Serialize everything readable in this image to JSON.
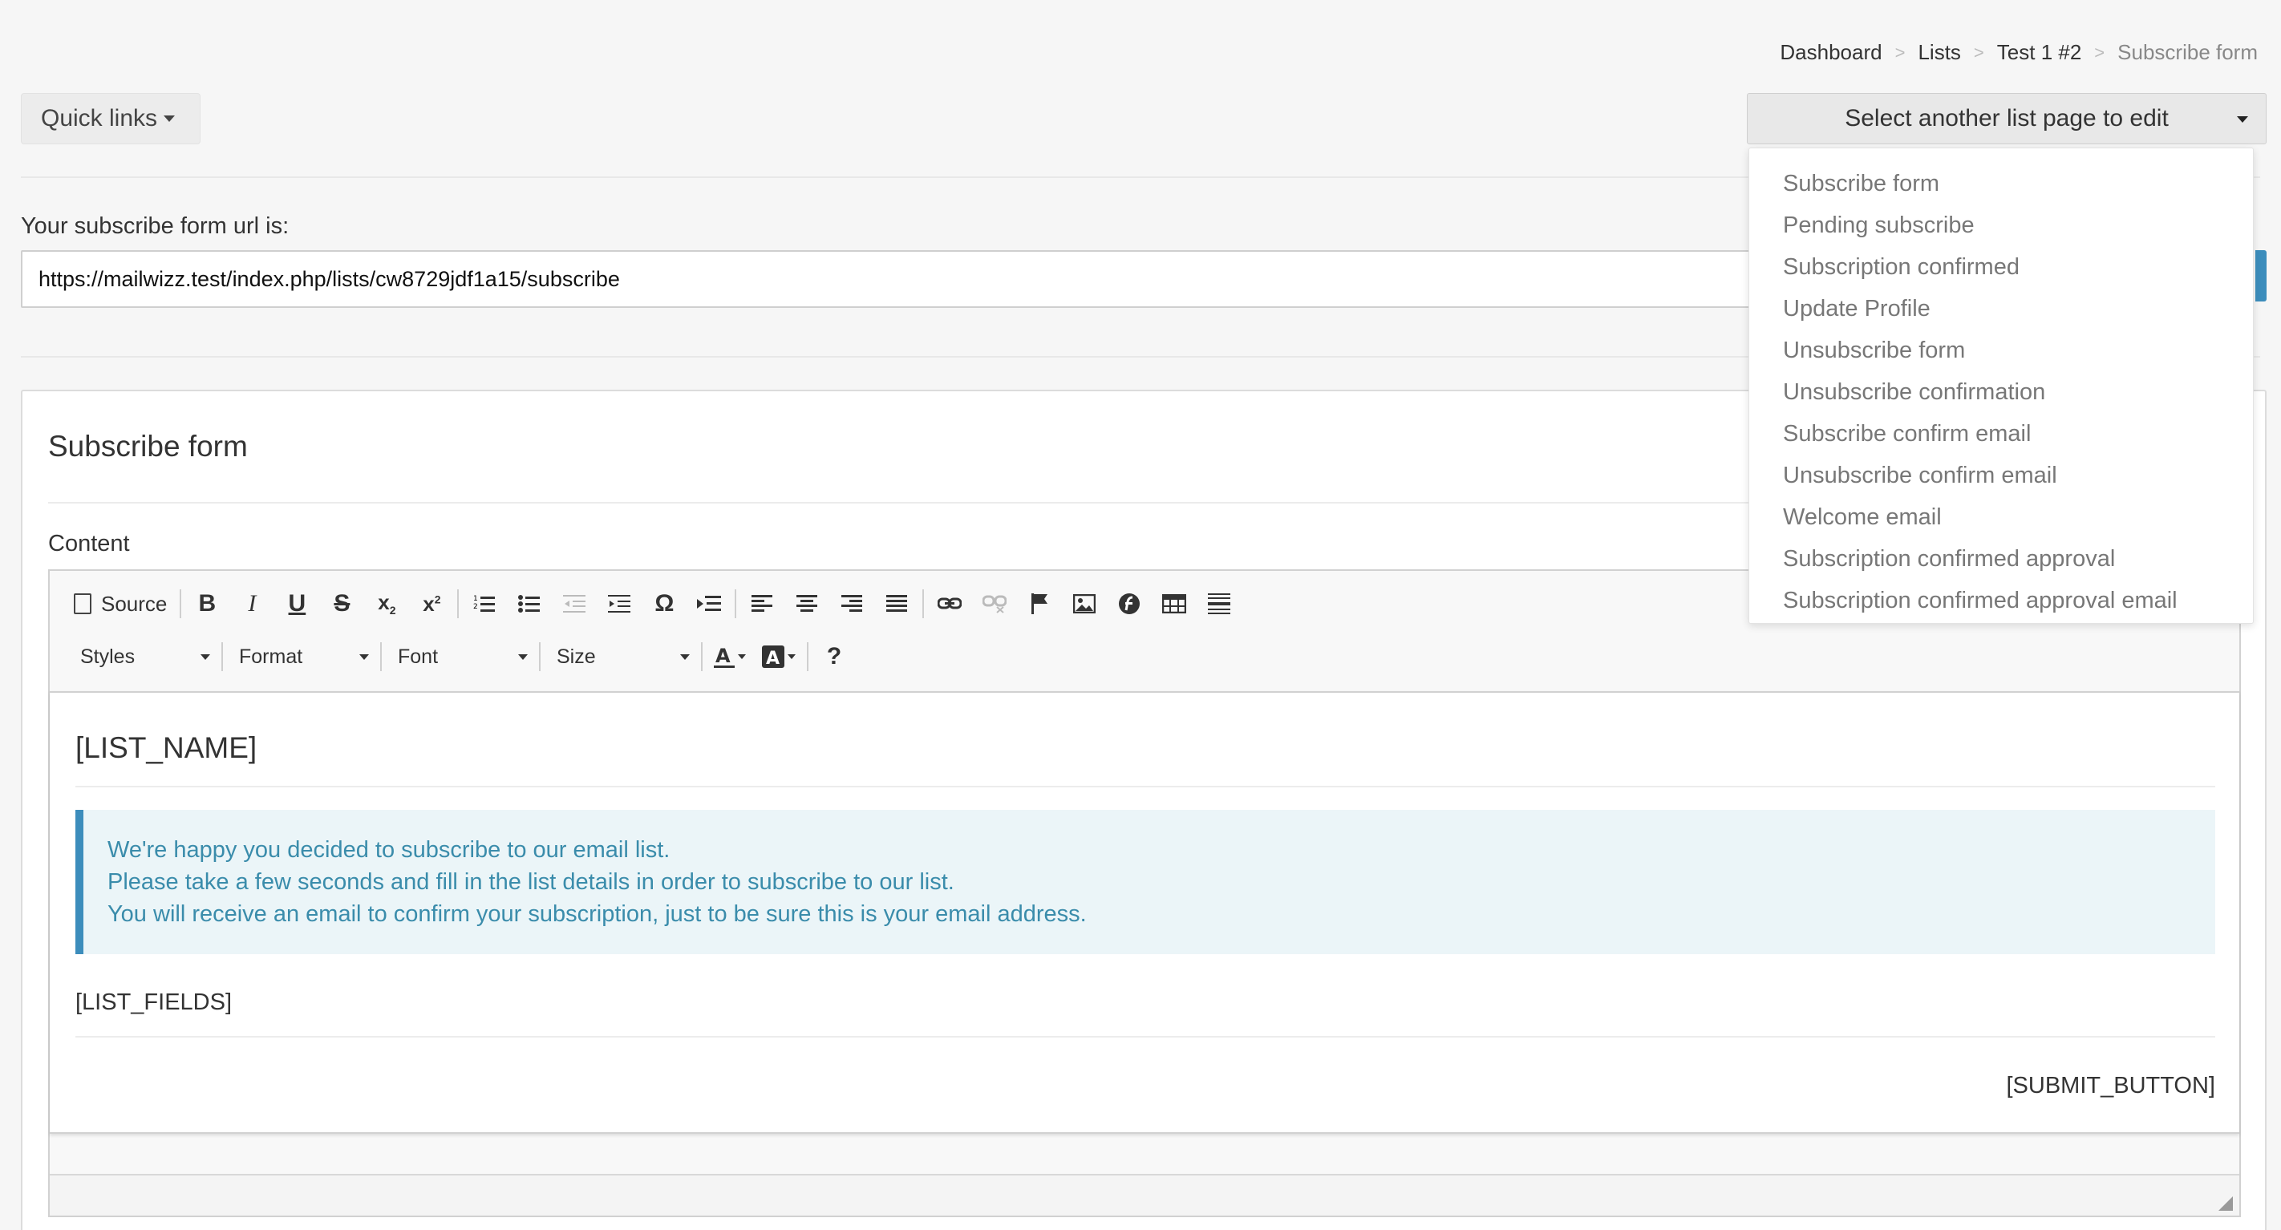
{
  "breadcrumb": {
    "items": [
      "Dashboard",
      "Lists",
      "Test 1 #2",
      "Subscribe form"
    ],
    "separator": ">"
  },
  "quick_links": {
    "label": "Quick links"
  },
  "select_page": {
    "label": "Select another list page to edit",
    "options": [
      "Subscribe form",
      "Pending subscribe",
      "Subscription confirmed",
      "Update Profile",
      "Unsubscribe form",
      "Unsubscribe confirmation",
      "Subscribe confirm email",
      "Unsubscribe confirm email",
      "Welcome email",
      "Subscription confirmed approval",
      "Subscription confirmed approval email"
    ]
  },
  "subscribe_url": {
    "label": "Your subscribe form url is:",
    "value": "https://mailwizz.test/index.php/lists/cw8729jdf1a15/subscribe"
  },
  "box": {
    "title": "Subscribe form",
    "content_label": "Content"
  },
  "editor": {
    "toolbar": {
      "source_label": "Source",
      "styles_label": "Styles",
      "format_label": "Format",
      "font_label": "Font",
      "size_label": "Size",
      "help_label": "?"
    },
    "body": {
      "list_name": "[LIST_NAME]",
      "callout_lines": [
        "We're happy you decided to subscribe to our email list.",
        "Please take a few seconds and fill in the list details in order to subscribe to our list.",
        "You will receive an email to confirm your subscription, just to be sure this is your email address."
      ],
      "list_fields": "[LIST_FIELDS]",
      "submit_button": "[SUBMIT_BUTTON]"
    }
  },
  "colors": {
    "accent": "#3c8dbc",
    "callout_bg": "#ebf5f8",
    "callout_text": "#3a8cab",
    "page_bg": "#f6f6f6"
  }
}
